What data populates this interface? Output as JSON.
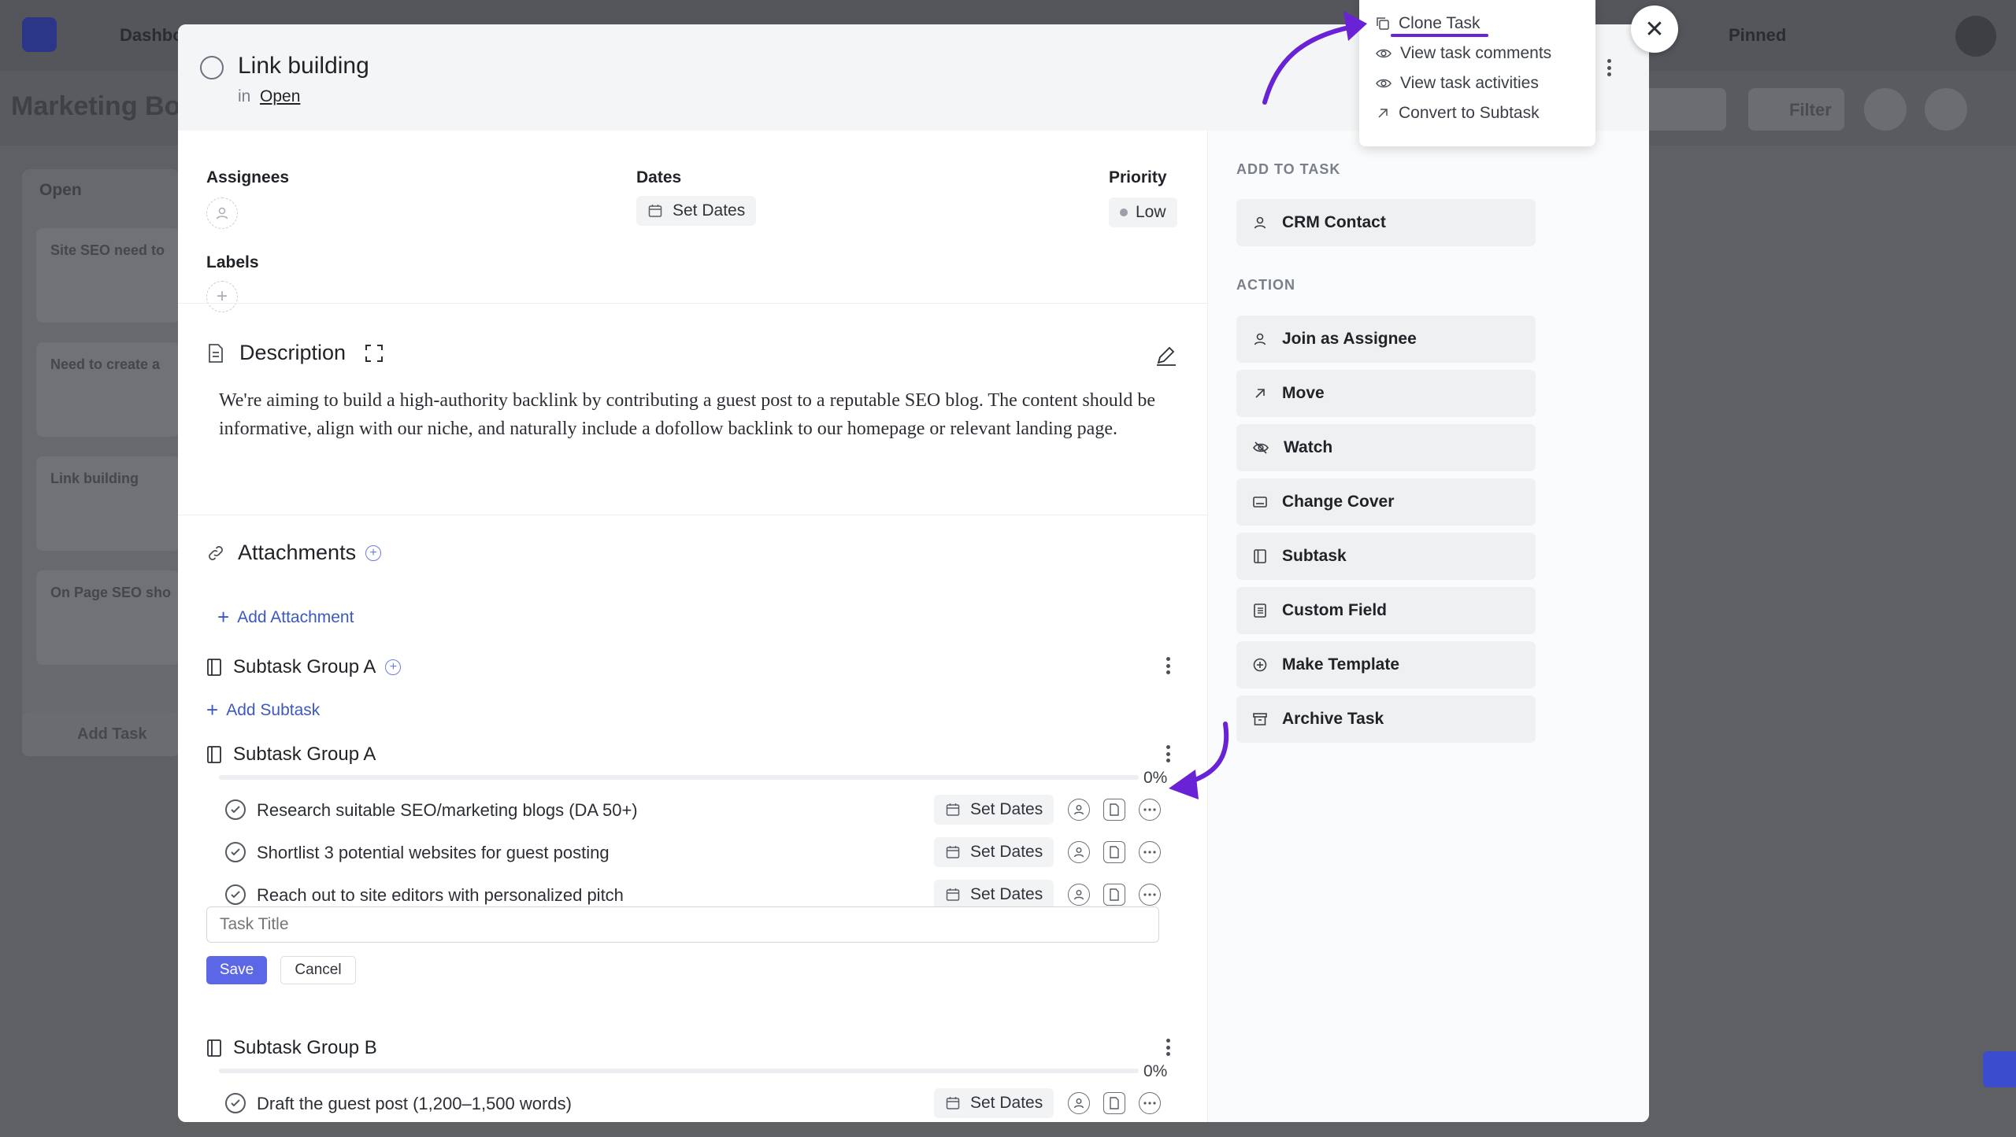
{
  "background": {
    "nav_item": "Dashbo",
    "pinned": "Pinned",
    "board_title": "Marketing Boa",
    "filter": "Filter",
    "column_title": "Open",
    "cards": [
      "Site SEO need to",
      "Need to create a",
      "Link building",
      "On Page SEO sho"
    ],
    "add_task": "Add Task"
  },
  "task": {
    "title": "Link building",
    "in_label": "in",
    "status": "Open"
  },
  "fields": {
    "assignees_label": "Assignees",
    "dates_label": "Dates",
    "dates_value": "Set Dates",
    "priority_label": "Priority",
    "priority_value": "Low",
    "labels_label": "Labels"
  },
  "description": {
    "title": "Description",
    "text": "We're aiming to build a high-authority backlink by contributing a guest post to a reputable SEO blog. The content should be informative, align with our niche, and naturally include a dofollow backlink to our homepage or relevant landing page."
  },
  "attachments": {
    "title": "Attachments",
    "add_label": "Add Attachment"
  },
  "groups": [
    {
      "title": "Subtask Group A",
      "add_label": "Add Subtask"
    },
    {
      "title": "Subtask Group A",
      "progress": "0%",
      "progress_fraction": 0,
      "subtasks": [
        {
          "text": "Research suitable SEO/marketing blogs (DA 50+)",
          "dates": "Set Dates"
        },
        {
          "text": "Shortlist 3 potential websites for guest posting",
          "dates": "Set Dates"
        },
        {
          "text": "Reach out to site editors with personalized pitch",
          "dates": "Set Dates"
        }
      ],
      "input_placeholder": "Task Title",
      "save_label": "Save",
      "cancel_label": "Cancel"
    },
    {
      "title": "Subtask Group B",
      "progress": "0%",
      "progress_fraction": 0,
      "subtasks": [
        {
          "text": "Draft the guest post (1,200–1,500 words)",
          "dates": "Set Dates"
        }
      ]
    }
  ],
  "sidebar": {
    "add_to_task_heading": "ADD TO TASK",
    "crm_contact": "CRM Contact",
    "action_heading": "ACTION",
    "actions": [
      {
        "label": "Join as Assignee",
        "icon": "user-icon"
      },
      {
        "label": "Move",
        "icon": "arrow-up-right-icon"
      },
      {
        "label": "Watch",
        "icon": "eye-off-icon"
      },
      {
        "label": "Change Cover",
        "icon": "image-icon"
      },
      {
        "label": "Subtask",
        "icon": "subtask-icon"
      },
      {
        "label": "Custom Field",
        "icon": "list-icon"
      },
      {
        "label": "Make Template",
        "icon": "plus-circle-icon"
      },
      {
        "label": "Archive Task",
        "icon": "archive-icon"
      }
    ]
  },
  "dropdown": {
    "items": [
      {
        "label": "Clone Task",
        "icon": "copy-icon"
      },
      {
        "label": "View task comments",
        "icon": "eye-icon"
      },
      {
        "label": "View task activities",
        "icon": "eye-icon"
      },
      {
        "label": "Convert to Subtask",
        "icon": "arrow-up-right-icon"
      }
    ]
  },
  "colors": {
    "accent": "#5b67e6",
    "annotation": "#6a22d6",
    "link": "#3b58c4"
  }
}
